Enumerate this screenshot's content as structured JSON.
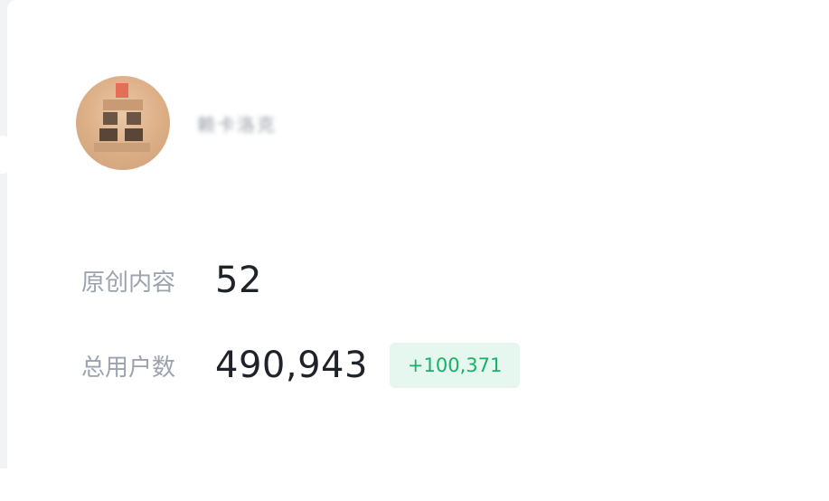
{
  "profile": {
    "avatar_icon": "user-avatar-icon",
    "username": "赖卡洛克"
  },
  "stats": [
    {
      "label": "原创内容",
      "value": "52"
    },
    {
      "label": "总用户数",
      "value": "490,943",
      "delta": "+100,371"
    }
  ],
  "colors": {
    "label": "#9ba3ad",
    "value": "#1f2329",
    "delta_text": "#15b26b",
    "delta_bg": "#e5f7ee"
  }
}
